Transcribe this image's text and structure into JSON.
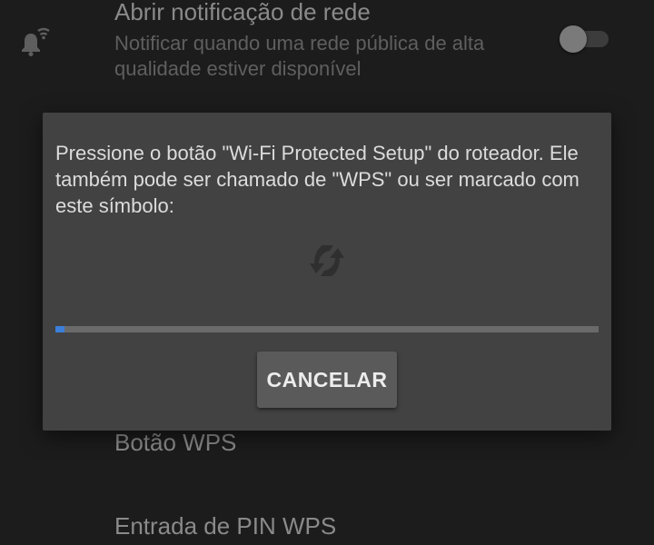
{
  "settings": {
    "open_network_notification": {
      "title": "Abrir notificação de rede",
      "summary": "Notificar quando uma rede pública de alta qualidade estiver disponível",
      "toggle_on": false,
      "icon": "wifi-bell-icon"
    },
    "wps_button": {
      "title": "Botão WPS"
    },
    "wps_pin": {
      "title": "Entrada de PIN WPS"
    }
  },
  "dialog": {
    "message": "Pressione o botão \"Wi-Fi Protected Setup\" do roteador. Ele também pode ser chamado de \"WPS\" ou ser marcado com este símbolo:",
    "symbol_icon": "wps-symbol-icon",
    "progress_fraction": 0.017,
    "cancel_label": "CANCELAR"
  },
  "colors": {
    "background": "#1c1c1c",
    "dialog": "#424242",
    "accent": "#3b7fd9"
  }
}
